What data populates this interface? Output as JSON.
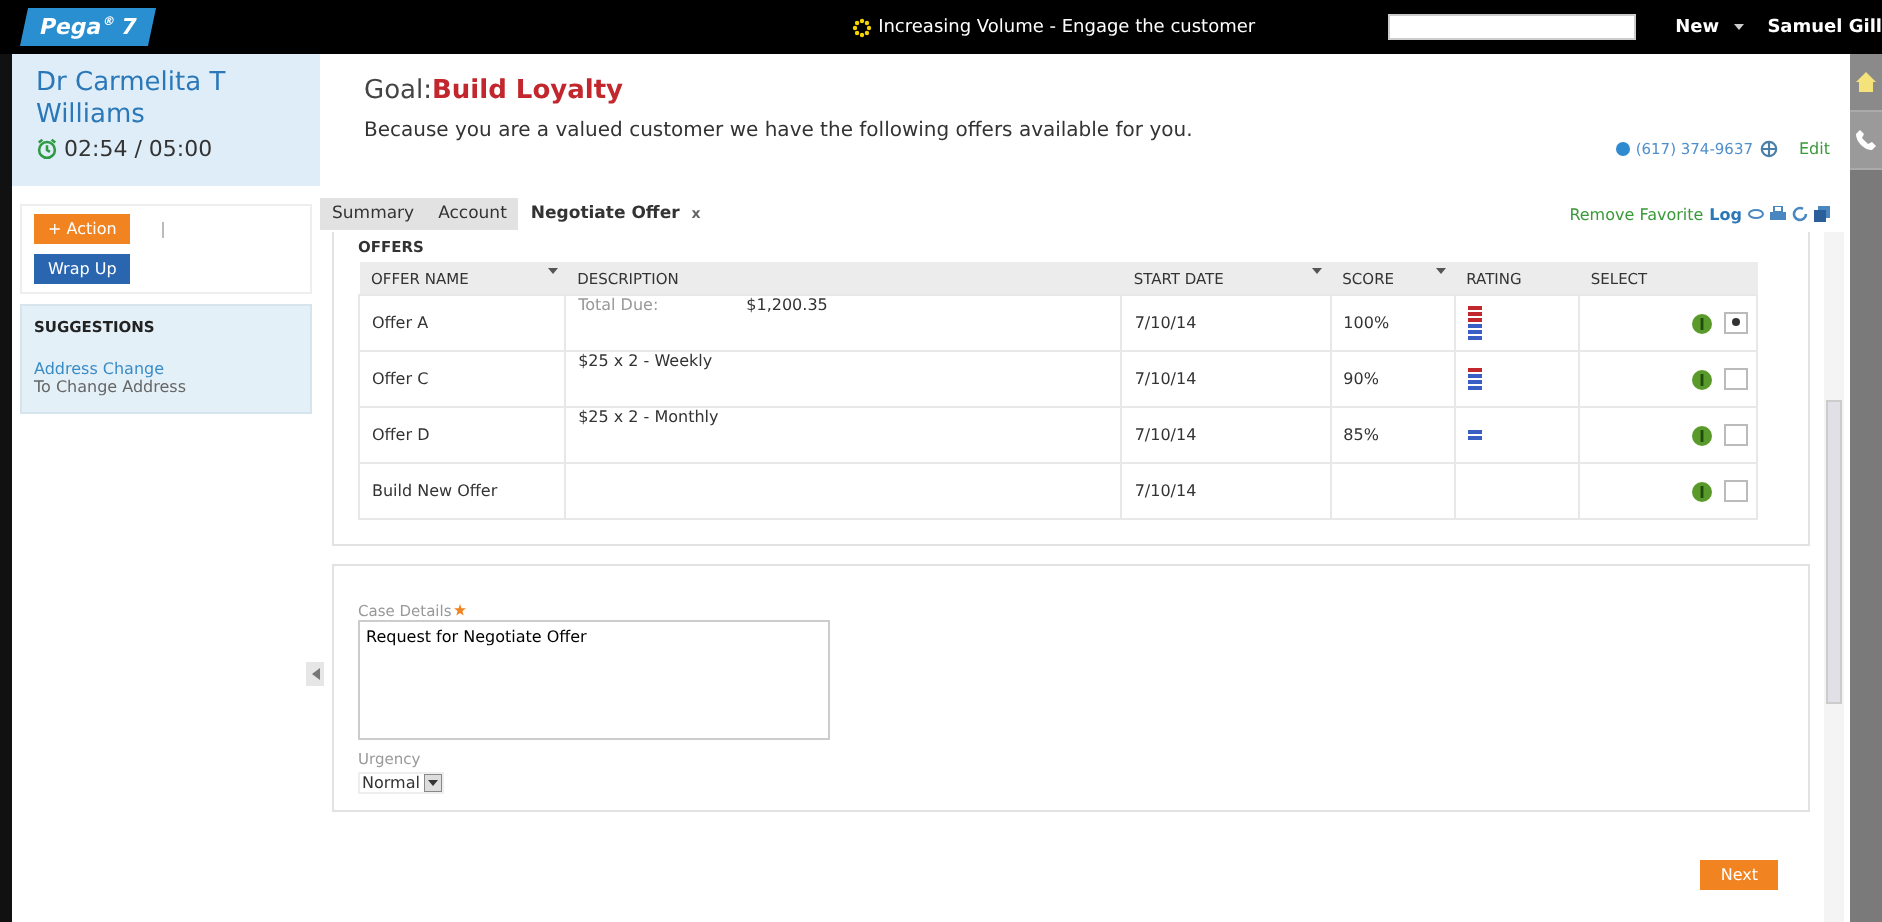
{
  "top_bar": {
    "logo": "Pega$^{®}$",
    "version": "7",
    "alert": "Increasing Volume - Engage the customer",
    "new_menu": "New",
    "user": "Samuel Gill"
  },
  "customer": {
    "name": "Dr Carmelita T Williams",
    "timer": "02:54 / 05:00"
  },
  "actions": [
    {
      "label": "+ Action",
      "kind": "primary"
    },
    {
      "label": "Wrap Up",
      "kind": "secondary"
    }
  ],
  "suggestions": {
    "title": "SUGGESTIONS",
    "items": [
      {
        "link": "Address Change",
        "detail": "To Change Address"
      }
    ]
  },
  "goal": {
    "label": "Goal:",
    "value": "Build Loyalty",
    "message": "Because you are a valued customer we have the following offers available for you."
  },
  "contact": {
    "phone": "(617) 374-9637",
    "edit": "Edit"
  },
  "tabs": [
    {
      "label": "Summary",
      "selected": false,
      "closable": false
    },
    {
      "label": "Account",
      "selected": false,
      "closable": false
    },
    {
      "label": "Negotiate Offer",
      "selected": true,
      "closable": true,
      "close": "x"
    }
  ],
  "tab_actions": {
    "favorite": "Remove Favorite",
    "log": "Log"
  },
  "offers": {
    "title": "OFFERS",
    "columns": [
      {
        "label": "OFFER NAME",
        "sortable": true
      },
      {
        "label": "DESCRIPTION",
        "sortable": false
      },
      {
        "label": "START DATE",
        "sortable": true
      },
      {
        "label": "SCORE",
        "sortable": true
      },
      {
        "label": "RATING",
        "sortable": false
      },
      {
        "label": "SELECT",
        "sortable": false
      }
    ],
    "rows": [
      {
        "name": "Offer A",
        "description_label": "Total Due:",
        "description": "$1,200.35",
        "start_date": "7/10/14",
        "score": "100%",
        "selected": true
      },
      {
        "name": "Offer C",
        "description": "$25 x 2 - Weekly",
        "start_date": "7/10/14",
        "score": "90%",
        "selected": false
      },
      {
        "name": "Offer D",
        "description": "$25 x 2 - Monthly",
        "start_date": "7/10/14",
        "score": "85%",
        "selected": false
      },
      {
        "name": "Build New Offer",
        "start_date": "7/10/14",
        "selected": false
      }
    ]
  },
  "case_details": {
    "label": "Case Details",
    "required": true,
    "value": "Request for Negotiate Offer"
  },
  "urgency": {
    "label": "Urgency",
    "value": "Normal"
  },
  "buttons": [
    "Next"
  ]
}
